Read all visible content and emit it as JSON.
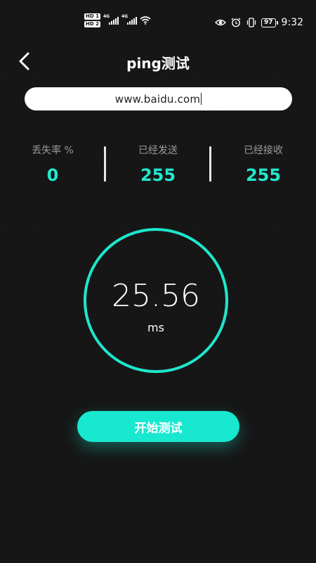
{
  "status_bar": {
    "sim1": "HD 1",
    "sim2": "HD 2",
    "net1": "4G",
    "net2": "4G",
    "battery": "97",
    "time": "9:32"
  },
  "header": {
    "title": "ping测试"
  },
  "url_input": {
    "value": "www.baidu.com"
  },
  "stats": {
    "loss": {
      "label": "丢失率 %",
      "value": "0"
    },
    "sent": {
      "label": "已经发送",
      "value": "255"
    },
    "received": {
      "label": "已经接收",
      "value": "255"
    }
  },
  "result": {
    "value": "25.56",
    "unit": "ms"
  },
  "start_button": {
    "label": "开始测试"
  },
  "colors": {
    "background": "#141414",
    "accent": "#1ee6cb",
    "stat_label": "#9a9a9a"
  }
}
